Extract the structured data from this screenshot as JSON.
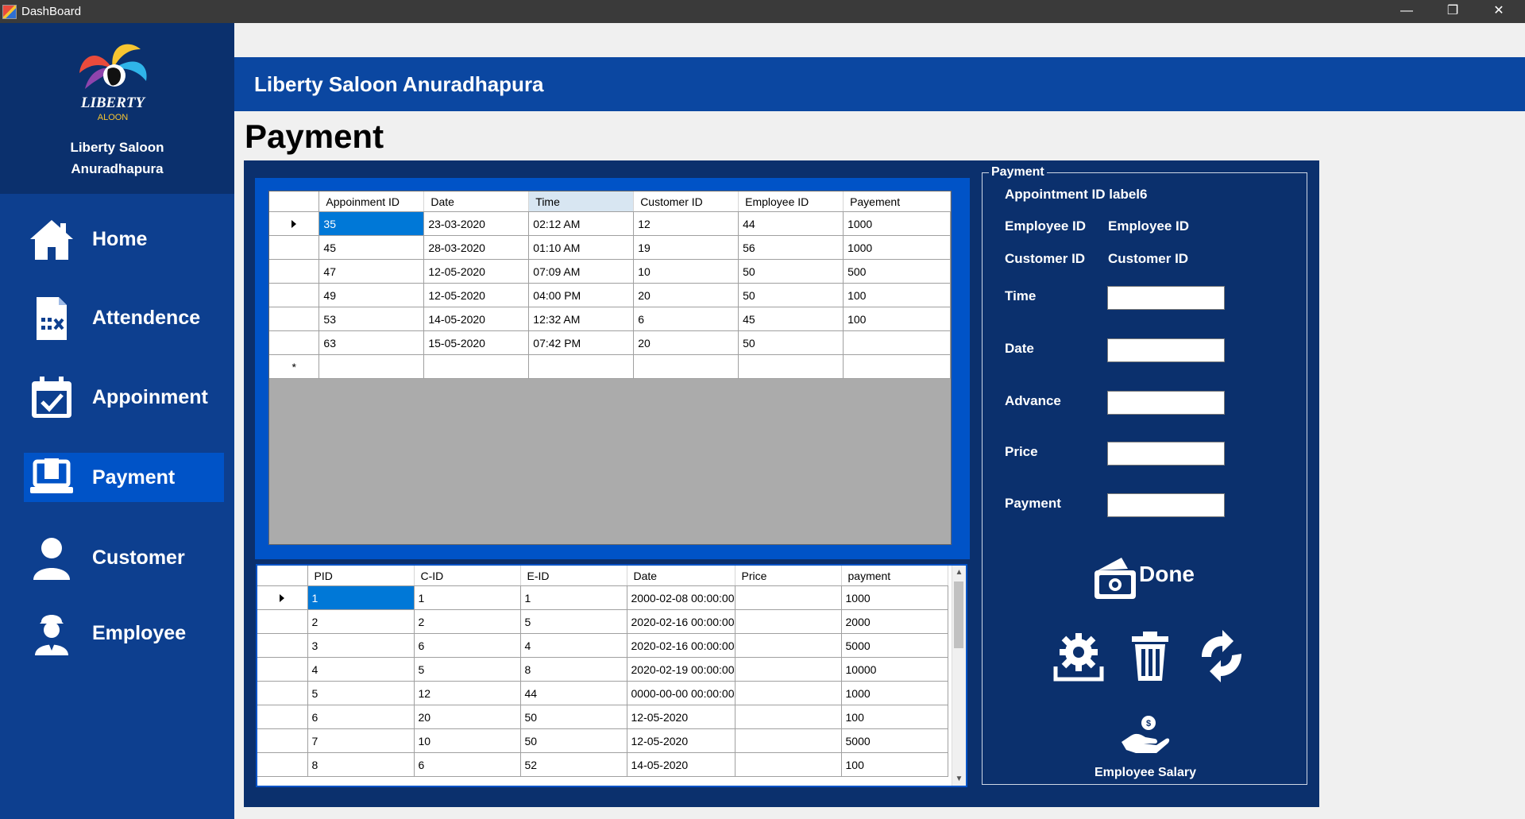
{
  "window": {
    "title": "DashBoard",
    "minimize": "—",
    "maximize": "❐",
    "close": "✕"
  },
  "brand": {
    "line1": "Liberty Saloon",
    "line2": "Anuradhapura"
  },
  "sidebar": {
    "items": [
      {
        "label": "Home",
        "icon": "home-icon"
      },
      {
        "label": "Attendence",
        "icon": "checklist-icon"
      },
      {
        "label": "Appoinment",
        "icon": "calendar-check-icon"
      },
      {
        "label": "Payment",
        "icon": "laptop-icon",
        "active": true
      },
      {
        "label": "Customer",
        "icon": "user-icon"
      },
      {
        "label": "Employee",
        "icon": "worker-icon"
      }
    ]
  },
  "header": {
    "title": "Liberty Saloon Anuradhapura"
  },
  "page": {
    "title": "Payment"
  },
  "appointments_grid": {
    "columns": [
      "Appoinment ID",
      "Date",
      "Time",
      "Customer ID",
      "Employee ID",
      "Payement"
    ],
    "rows": [
      [
        "35",
        "23-03-2020",
        "02:12 AM",
        "12",
        "44",
        "1000"
      ],
      [
        "45",
        "28-03-2020",
        "01:10 AM",
        "19",
        "56",
        "1000"
      ],
      [
        "47",
        "12-05-2020",
        "07:09 AM",
        "10",
        "50",
        "500"
      ],
      [
        "49",
        "12-05-2020",
        "04:00 PM",
        "20",
        "50",
        "100"
      ],
      [
        "53",
        "14-05-2020",
        "12:32 AM",
        "6",
        "45",
        "100"
      ],
      [
        "63",
        "15-05-2020",
        "07:42 PM",
        "20",
        "50",
        ""
      ]
    ],
    "new_row_marker": "*"
  },
  "payments_grid": {
    "columns": [
      "PID",
      "C-ID",
      "E-ID",
      "Date",
      "Price",
      "payment"
    ],
    "rows": [
      [
        "1",
        "1",
        "1",
        "2000-02-08 00:00:00",
        "",
        "1000"
      ],
      [
        "2",
        "2",
        "5",
        "2020-02-16 00:00:00",
        "",
        "2000"
      ],
      [
        "3",
        "6",
        "4",
        "2020-02-16 00:00:00",
        "",
        "5000"
      ],
      [
        "4",
        "5",
        "8",
        "2020-02-19 00:00:00",
        "",
        "10000"
      ],
      [
        "5",
        "12",
        "44",
        "0000-00-00 00:00:00",
        "",
        "1000"
      ],
      [
        "6",
        "20",
        "50",
        " 12-05-2020",
        "",
        "100"
      ],
      [
        "7",
        "10",
        "50",
        " 12-05-2020",
        "",
        "5000"
      ],
      [
        "8",
        "6",
        "52",
        " 14-05-2020",
        "",
        "100"
      ]
    ]
  },
  "form": {
    "legend": "Payment",
    "appointment_id": "Appointment ID label6",
    "employee_id_label": "Employee ID",
    "employee_id_value": "Employee ID",
    "customer_id_label": "Customer ID",
    "customer_id_value": "Customer ID",
    "time_label": "Time",
    "date_label": "Date",
    "advance_label": "Advance",
    "price_label": "Price",
    "payment_label": "Payment",
    "time_value": "",
    "date_value": "",
    "advance_value": "",
    "price_value": "",
    "payment_value": "",
    "done_label": "Done",
    "salary_label": "Employee Salary"
  },
  "colors": {
    "sidebar": "#0d3f8f",
    "brand_panel": "#0b306d",
    "header": "#0b47a1",
    "active_nav": "#0053c7",
    "selection": "#0078d7"
  }
}
